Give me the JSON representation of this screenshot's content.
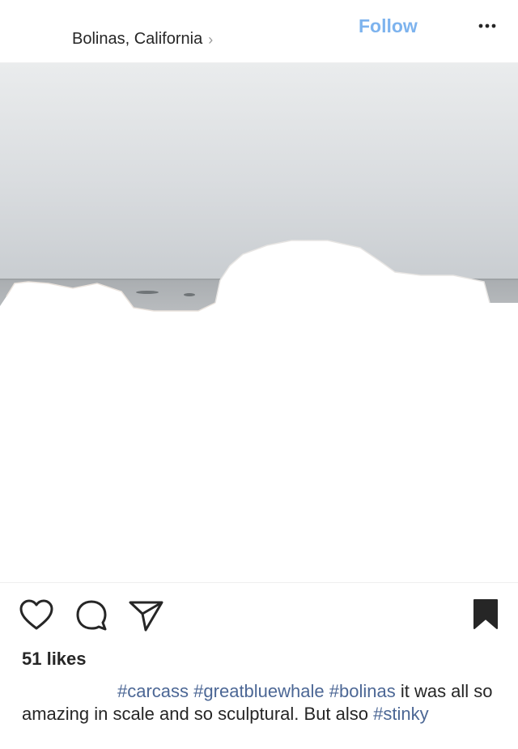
{
  "header": {
    "location": "Bolinas, California",
    "follow_label": "Follow"
  },
  "icons": {
    "location_chevron": "chevron-right-icon",
    "more": "more-dots-icon",
    "like": "heart-icon",
    "comment": "comment-icon",
    "share": "send-icon",
    "save": "bookmark-icon"
  },
  "post": {
    "likes": "51 likes",
    "caption": {
      "tags_start": [
        "#carcass",
        "#greatbluewhale",
        "#bolinas"
      ],
      "text": " it was all so amazing in scale and so sculptural. But also ",
      "tag_end": "#stinky"
    }
  },
  "colors": {
    "follow": "#7db3ee",
    "hashtag": "#4c6795",
    "text": "#262626"
  }
}
